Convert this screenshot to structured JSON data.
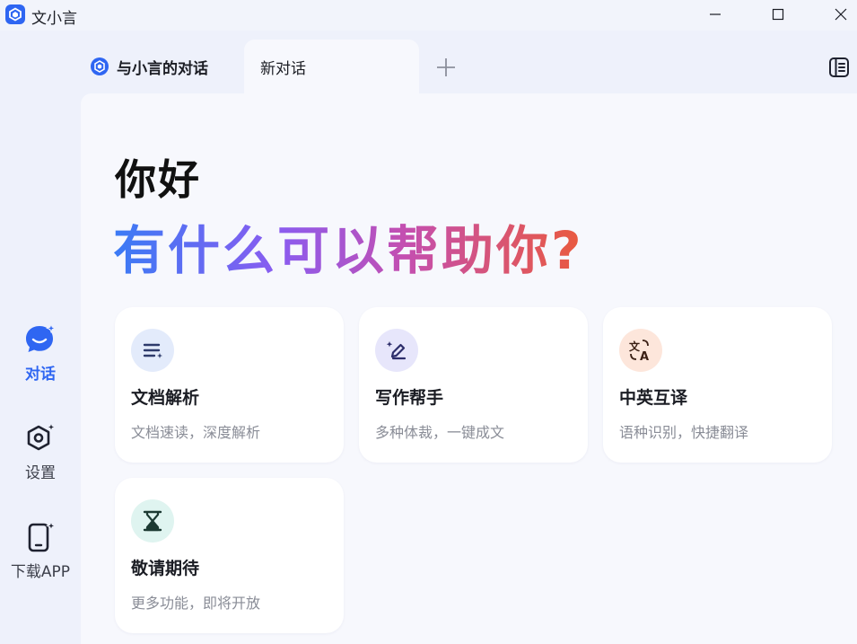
{
  "app": {
    "title": "文小言"
  },
  "rail": {
    "items": [
      {
        "label": "对话",
        "icon": "chat-bubble-icon",
        "active": true
      },
      {
        "label": "设置",
        "icon": "settings-hexagon-icon",
        "active": false
      },
      {
        "label": "下载APP",
        "icon": "phone-icon",
        "active": false
      }
    ]
  },
  "tabs": {
    "pinned": "与小言的对话",
    "active": "新对话"
  },
  "main": {
    "greeting": "你好",
    "headline": "有什么可以帮助你?"
  },
  "cards": [
    {
      "title": "文档解析",
      "subtitle": "文档速读，深度解析",
      "icon": "document-lines-icon",
      "icon_bg": "#e3ebfb"
    },
    {
      "title": "写作帮手",
      "subtitle": "多种体裁，一键成文",
      "icon": "pen-sparkle-icon",
      "icon_bg": "#e7e6fb"
    },
    {
      "title": "中英互译",
      "subtitle": "语种识别，快捷翻译",
      "icon": "translate-icon",
      "icon_bg": "#fde6db"
    },
    {
      "title": "敬请期待",
      "subtitle": "更多功能，即将开放",
      "icon": "hourglass-icon",
      "icon_bg": "#dff4f0"
    }
  ],
  "colors": {
    "accent": "#2f66f2",
    "background": "#eef1fb",
    "panel": "#f7f8fd"
  }
}
